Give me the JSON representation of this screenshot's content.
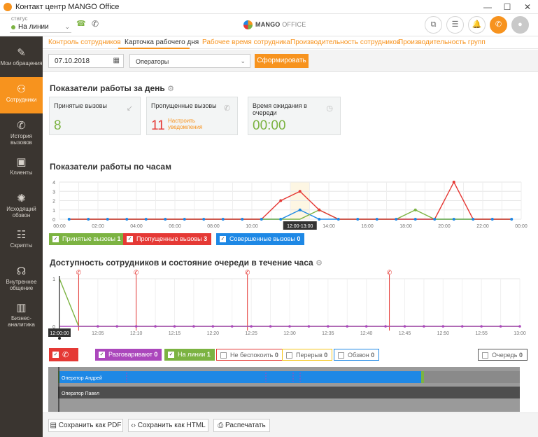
{
  "window": {
    "title": "Контакт центр MANGO Office",
    "minimize": "—",
    "maximize": "☐",
    "close": "✕"
  },
  "header": {
    "status_caption": "статус",
    "status_value": "На линии",
    "brand": "MANGO",
    "brand_suffix": "OFFICE"
  },
  "sidebar": {
    "items": [
      {
        "label": "Мои обращения",
        "icon": "edit-icon"
      },
      {
        "label": "Сотрудники",
        "icon": "team-chart-icon"
      },
      {
        "label": "История вызовов",
        "icon": "call-history-icon"
      },
      {
        "label": "Клиенты",
        "icon": "briefcase-icon"
      },
      {
        "label": "Исходящий обзвон",
        "icon": "octopus-icon"
      },
      {
        "label": "Скрипты",
        "icon": "scripts-icon"
      },
      {
        "label": "Внутреннее общение",
        "icon": "headset-chat-icon"
      },
      {
        "label": "Бизнес-аналитика",
        "icon": "analytics-icon"
      }
    ],
    "active_index": 1
  },
  "tabs": [
    "Контроль сотрудников",
    "Карточка рабочего дня",
    "Рабочее время сотрудника",
    "Производительность сотрудников",
    "Производительность групп"
  ],
  "active_tab": 1,
  "filters": {
    "date": "07.10.2018",
    "group": "Операторы",
    "submit": "Сформировать"
  },
  "section_day": {
    "title": "Показатели работы за день",
    "cards": [
      {
        "title": "Принятые вызовы",
        "value": "8",
        "color": "#7cb342"
      },
      {
        "title": "Пропущенные вызовы",
        "value": "11",
        "color": "#e53935",
        "link": "Настроить уведомления"
      },
      {
        "title": "Время ожидания в очереди",
        "value": "00:00",
        "color": "#7cb342"
      }
    ]
  },
  "section_hours": {
    "title": "Показатели работы по часам",
    "tooltip": "12:00-13:00",
    "legend": [
      {
        "label": "Принятые вызовы",
        "count": "1",
        "color": "#7cb342"
      },
      {
        "label": "Пропущенные вызовы",
        "count": "3",
        "color": "#e53935"
      },
      {
        "label": "Совершенные вызовы",
        "count": "0",
        "color": "#1e88e5"
      }
    ]
  },
  "section_avail": {
    "title": "Доступность сотрудников и состояние очереди в течение часа",
    "tooltip": "12:00:00",
    "legend": [
      {
        "label": "Разговаривают",
        "count": "0",
        "color": "#ab47bc",
        "filled": true
      },
      {
        "label": "На линии",
        "count": "1",
        "color": "#7cb342",
        "filled": true
      },
      {
        "label": "Не беспокоить",
        "count": "0",
        "color": "#e53935",
        "filled": false
      },
      {
        "label": "Перерыв",
        "count": "0",
        "color": "#f5c518",
        "filled": false
      },
      {
        "label": "Обзвон",
        "count": "0",
        "color": "#1e88e5",
        "filled": false
      },
      {
        "label": "Очередь",
        "count": "0",
        "color": "#555555",
        "filled": false
      }
    ],
    "operators": [
      "Оператор Андрей",
      "Оператор Павел"
    ]
  },
  "bottom": {
    "pdf": "Сохранить как PDF",
    "html": "Сохранить как HTML",
    "print": "Распечатать"
  },
  "chart_data": [
    {
      "type": "line",
      "title": "Показатели работы по часам",
      "categories": [
        "00:00",
        "01:00",
        "02:00",
        "03:00",
        "04:00",
        "05:00",
        "06:00",
        "07:00",
        "08:00",
        "09:00",
        "10:00",
        "11:00",
        "12:00",
        "13:00",
        "14:00",
        "15:00",
        "16:00",
        "17:00",
        "18:00",
        "19:00",
        "20:00",
        "21:00",
        "22:00",
        "23:00"
      ],
      "tick_labels": [
        "00:00",
        "02:00",
        "04:00",
        "06:00",
        "08:00",
        "10:00",
        "12:00",
        "14:00",
        "16:00",
        "18:00",
        "20:00",
        "22:00",
        "00:00"
      ],
      "ylim": [
        0,
        4
      ],
      "yticks": [
        0,
        1,
        2,
        3,
        4
      ],
      "grid": true,
      "series": [
        {
          "name": "Принятые вызовы",
          "color": "#7cb342",
          "values": [
            0,
            0,
            0,
            0,
            0,
            0,
            0,
            0,
            0,
            0,
            0,
            0,
            0,
            1,
            0,
            0,
            0,
            0,
            1,
            0,
            0,
            0,
            0,
            0
          ]
        },
        {
          "name": "Пропущенные вызовы",
          "color": "#e53935",
          "values": [
            0,
            0,
            0,
            0,
            0,
            0,
            0,
            0,
            0,
            0,
            0,
            2,
            3,
            1,
            0,
            0,
            0,
            0,
            0,
            0,
            4,
            0,
            0,
            0
          ]
        },
        {
          "name": "Совершенные вызовы",
          "color": "#1e88e5",
          "values": [
            0,
            0,
            0,
            0,
            0,
            0,
            0,
            0,
            0,
            0,
            0,
            0,
            1,
            0,
            0,
            0,
            0,
            0,
            0,
            0,
            0,
            0,
            0,
            0
          ]
        }
      ]
    },
    {
      "type": "line",
      "title": "Доступность сотрудников и состояние очереди в течение часа",
      "tick_labels": [
        "12:00",
        "12:05",
        "12:10",
        "12:15",
        "12:20",
        "12:25",
        "12:30",
        "12:35",
        "12:40",
        "12:45",
        "12:50",
        "12:55",
        "13:00"
      ],
      "ylim": [
        0,
        1
      ],
      "yticks": [
        0,
        1
      ],
      "grid": true,
      "missed_call_marks_minutes": [
        2.5,
        10,
        24.5,
        43
      ],
      "series": [
        {
          "name": "На линии",
          "color": "#7cb342",
          "points": [
            [
              0,
              1
            ],
            [
              2.5,
              0
            ],
            [
              60,
              0
            ]
          ]
        },
        {
          "name": "Разговаривают",
          "color": "#ab47bc",
          "points": [
            [
              0,
              0
            ],
            [
              60,
              0
            ]
          ]
        }
      ]
    }
  ]
}
